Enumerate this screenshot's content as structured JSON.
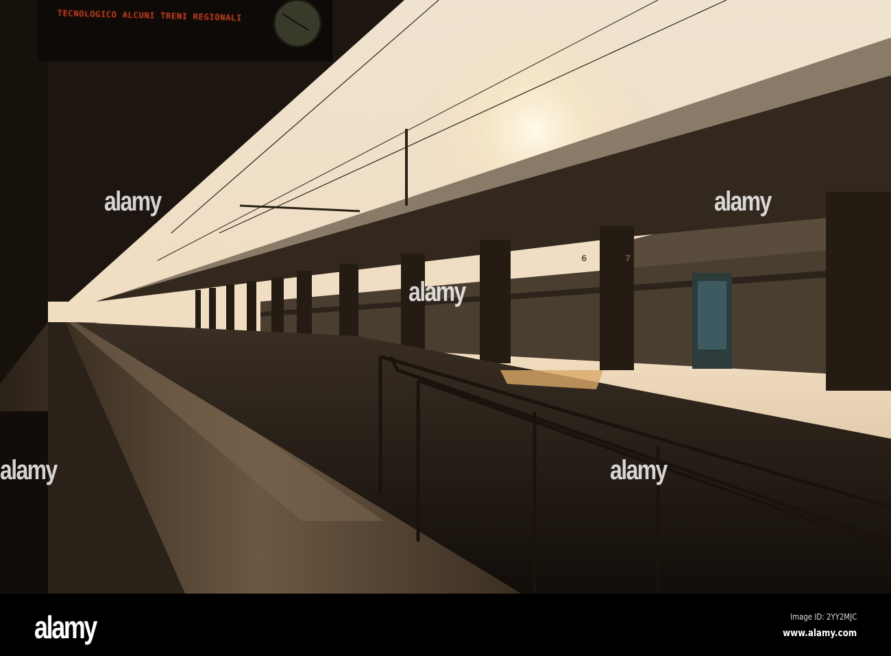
{
  "scene": {
    "departure_board_text": "TECNOLOGICO ALCUNI TRENI REGIONALI",
    "platform_numbers": [
      "6",
      "7"
    ]
  },
  "watermark": {
    "text": "alamy"
  },
  "footer": {
    "logo": "alamy",
    "image_id": "Image ID: 2YY2MJC",
    "url": "www.alamy.com"
  },
  "colors": {
    "sky": "#f3e6cf",
    "sun": "#fff6d8",
    "shadow": "#17110c",
    "led": "#d24a2a"
  }
}
